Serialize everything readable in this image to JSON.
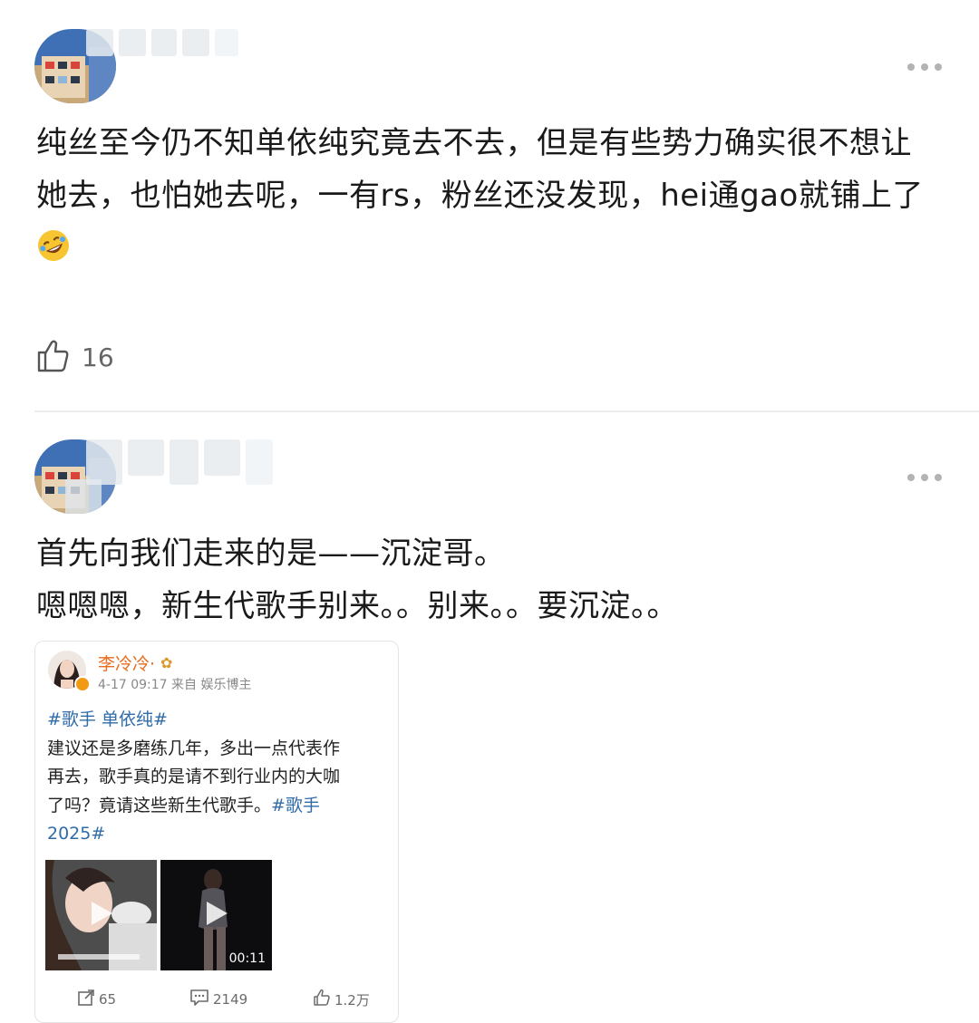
{
  "comments": [
    {
      "text_lines": [
        "纯丝至今仍不知单依纯究竟去不去，但是有些势力确实很不想让",
        "她去，也怕她去呢，一有rs，粉丝还没发现，hei通gao就铺上了"
      ],
      "emoji_icon": "rofl-emoji-icon",
      "likes": "16"
    },
    {
      "text_lines": [
        "首先向我们走来的是——沉淀哥。",
        "嗯嗯嗯，新生代歌手别来。。别来。。要沉淀。。"
      ],
      "quoted_post": {
        "author": "李冷冷",
        "author_suffix": "·",
        "meta": "4-17 09:17 来自 娱乐博主",
        "hashtag_line": "#歌手 单依纯#",
        "body_lines": [
          "建议还是多磨练几年，多出一点代表作",
          "再去，歌手真的是请不到行业内的大咖",
          "了吗？竟请这些新生代歌手。"
        ],
        "trailing_tag_a": "#歌手",
        "trailing_tag_b": "2025#",
        "video_duration": "00:11",
        "reposts": "65",
        "comments": "2149",
        "likes": "1.2万"
      }
    }
  ],
  "colors": {
    "accent_name": "#e86c1f",
    "hashtag": "#2f6ca8",
    "muted": "#888888"
  }
}
